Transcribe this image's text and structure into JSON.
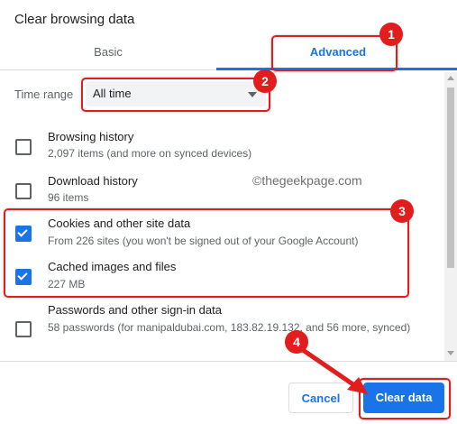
{
  "dialog": {
    "title": "Clear browsing data"
  },
  "tabs": [
    {
      "label": "Basic"
    },
    {
      "label": "Advanced"
    }
  ],
  "time_range": {
    "label": "Time range",
    "value": "All time"
  },
  "items": [
    {
      "title": "Browsing history",
      "subtitle": "2,097 items (and more on synced devices)",
      "checked": false
    },
    {
      "title": "Download history",
      "subtitle": "96 items",
      "checked": false
    },
    {
      "title": "Cookies and other site data",
      "subtitle": "From 226 sites (you won't be signed out of your Google Account)",
      "checked": true
    },
    {
      "title": "Cached images and files",
      "subtitle": "227 MB",
      "checked": true
    },
    {
      "title": "Passwords and other sign-in data",
      "subtitle": "58 passwords (for manipaldubai.com, 183.82.19.132, and 56 more, synced)",
      "checked": false
    }
  ],
  "watermark": "©thegeekpage.com",
  "buttons": {
    "cancel": "Cancel",
    "clear": "Clear data"
  },
  "annotations": {
    "one": "1",
    "two": "2",
    "three": "3",
    "four": "4"
  },
  "colors": {
    "accent": "#1a73e8",
    "annotation": "#e11d1d"
  }
}
